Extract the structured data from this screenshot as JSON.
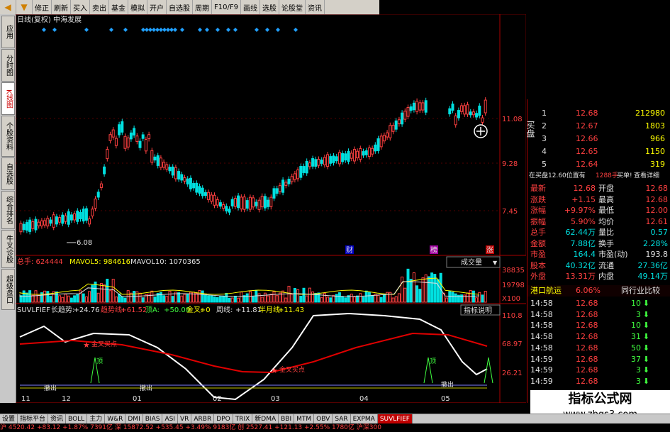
{
  "toolbar": {
    "buttons": [
      "修正",
      "刷新",
      "买入",
      "卖出",
      "基金",
      "模拟",
      "开户",
      "自选股",
      "周期",
      "F10/F9",
      "画线",
      "选股",
      "论股堂",
      "资讯"
    ]
  },
  "sidebar": {
    "tabs": [
      "应用",
      "分时图",
      "K线图",
      "个股资料",
      "自选股",
      "综合排名",
      "牛叉诊股",
      "超级盘口"
    ],
    "active": 2
  },
  "chart": {
    "title": "日线(复权)  中海发展",
    "price_ticks": [
      "11.08",
      "9.28",
      "7.45"
    ],
    "low_label": "6.08",
    "markers": [
      "财",
      "榜",
      "涨"
    ],
    "volume_label": "总手: 624444",
    "mavol5": "MAVOL5: 984616",
    "mavol10": "MAVOL10: 1070365",
    "volume_dropdown": "成交量",
    "vol_ticks": [
      "38835",
      "19798",
      "X100"
    ],
    "indicator_name": "SUVLFIEF",
    "indicator_items": [
      {
        "label": "长趋势:",
        "value": "+24.76"
      },
      {
        "label": "趋势线:",
        "value": "+61.52"
      },
      {
        "label": "顶A:",
        "value": "+50.00"
      },
      {
        "label": "金叉:",
        "value": "+0"
      },
      {
        "label": "周线:",
        "value": "+11.81"
      },
      {
        "label": "半月线:",
        "value": "+11.43"
      }
    ],
    "indicator_button": "指标说明",
    "ind_ticks": [
      "110.8",
      "68.97",
      "26.21"
    ],
    "annotations": [
      "金叉买点",
      "金叉买点"
    ],
    "top_labels": [
      "顶",
      "顶"
    ],
    "bottom_labels": [
      "撤出",
      "撤出",
      "撤出"
    ],
    "x_labels": [
      "11",
      "12",
      "01",
      "02",
      "03",
      "04",
      "05"
    ]
  },
  "orderbook": {
    "buy_side_label": "买盘",
    "rows": [
      {
        "idx": "1",
        "price": "12.68",
        "vol": "212980"
      },
      {
        "idx": "2",
        "price": "12.67",
        "vol": "1803"
      },
      {
        "idx": "3",
        "price": "12.66",
        "vol": "966"
      },
      {
        "idx": "4",
        "price": "12.65",
        "vol": "1150"
      },
      {
        "idx": "5",
        "price": "12.64",
        "vol": "319"
      }
    ],
    "notice": "在买盘12.60位置有",
    "notice_vol": "1288手",
    "notice_action": "买单!",
    "notice_link": "查看详细"
  },
  "quote": [
    {
      "l1": "最新",
      "v1": "12.68",
      "l2": "开盘",
      "v2": "12.68"
    },
    {
      "l1": "涨跌",
      "v1": "+1.15",
      "l2": "最高",
      "v2": "12.68"
    },
    {
      "l1": "涨幅",
      "v1": "+9.97%",
      "l2": "最低",
      "v2": "12.00"
    },
    {
      "l1": "振幅",
      "v1": "5.90%",
      "l2": "均价",
      "v2": "12.61"
    },
    {
      "l1": "总手",
      "v1": "62.44万",
      "l2": "量比",
      "v2": "0.57"
    },
    {
      "l1": "金额",
      "v1": "7.88亿",
      "l2": "换手",
      "v2": "2.28%"
    },
    {
      "l1": "市盈",
      "v1": "164.4",
      "l2": "市盈(动)",
      "v2": "193.8"
    },
    {
      "l1": "股本",
      "v1": "40.32亿",
      "l2": "流通",
      "v2": "27.36亿"
    },
    {
      "l1": "外盘",
      "v1": "13.31万",
      "l2": "内盘",
      "v2": "49.14万"
    }
  ],
  "sector": {
    "name": "港口航运",
    "pct": "6.06%",
    "button": "同行业比较"
  },
  "ticks": [
    {
      "time": "14:58",
      "price": "12.68",
      "vol": "10",
      "dir": "down"
    },
    {
      "time": "14:58",
      "price": "12.68",
      "vol": "3",
      "dir": "down"
    },
    {
      "time": "14:58",
      "price": "12.68",
      "vol": "10",
      "dir": "down"
    },
    {
      "time": "14:58",
      "price": "12.68",
      "vol": "31",
      "dir": "down"
    },
    {
      "time": "14:58",
      "price": "12.68",
      "vol": "50",
      "dir": "down"
    },
    {
      "time": "14:59",
      "price": "12.68",
      "vol": "37",
      "dir": "down"
    },
    {
      "time": "14:59",
      "price": "12.68",
      "vol": "3",
      "dir": "down"
    },
    {
      "time": "14:59",
      "price": "12.68",
      "vol": "3",
      "dir": "down"
    }
  ],
  "bottom_tabs": [
    "设置",
    "指标平台",
    "资讯",
    "BOLL",
    "主力",
    "W&R",
    "DMI",
    "BIAS",
    "ASI",
    "VR",
    "ARBR",
    "DPO",
    "TRIX",
    "新DMA",
    "BBI",
    "MTM",
    "OBV",
    "SAR",
    "EXPMA",
    "SUVLFIEF"
  ],
  "bottom_active": 19,
  "status_bar": "沪 4520.42  +83.12  +1.87%  7391亿 深 15872.52 +535.45 +3.49%  9183亿 创 2527.41 +121.13 +2.55%  1780亿 沪深300",
  "watermark": {
    "title": "指标公式网",
    "url": "www.zbgs3.com"
  },
  "colors": {
    "up": "#ff4040",
    "down": "#00e0e0",
    "white": "#e0e0e0",
    "yellow": "#ffff00",
    "frame": "#a00000"
  }
}
